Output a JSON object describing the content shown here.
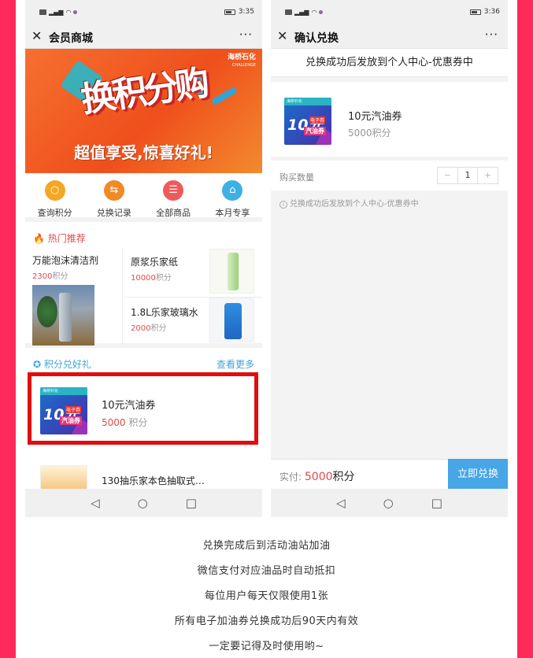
{
  "left_phone": {
    "status": {
      "time": "3:35",
      "battery": "67"
    },
    "nav": {
      "title": "会员商城",
      "more": "···",
      "close": "✕"
    },
    "banner": {
      "brand": "海桥石化",
      "brand_sub": "CHALLENGE",
      "headline": "换积分购",
      "subline": "超值享受,惊喜好礼!"
    },
    "quicknav": [
      {
        "label": "查询积分",
        "icon": "search-icon",
        "color": "#f5a623",
        "glyph": "○"
      },
      {
        "label": "兑换记录",
        "icon": "exchange-icon",
        "color": "#f08a24",
        "glyph": "⇆"
      },
      {
        "label": "全部商品",
        "icon": "list-icon",
        "color": "#ee5a5a",
        "glyph": "☰"
      },
      {
        "label": "本月专享",
        "icon": "gift-icon",
        "color": "#3db0e6",
        "glyph": "⌂"
      }
    ],
    "hot": {
      "title": "热门推荐",
      "items": [
        {
          "name": "万能泡沫清洁剂",
          "points": "2300",
          "unit": "积分"
        },
        {
          "name": "原浆乐家纸",
          "points": "10000",
          "unit": "积分"
        },
        {
          "name": "1.8L乐家玻璃水",
          "points": "2000",
          "unit": "积分"
        }
      ]
    },
    "exchange": {
      "title": "积分兑好礼",
      "see_more": "查看更多",
      "item1": {
        "name": "10元汽油券",
        "points": "5000",
        "unit": " 积分"
      },
      "item2": {
        "name": "130抽乐家本色抽取式…"
      }
    },
    "coupon_art": {
      "mini": "海桥石化",
      "ten": "10元",
      "tag": "电子券",
      "gas": "汽油券"
    }
  },
  "right_phone": {
    "status": {
      "time": "3:36",
      "battery": "67"
    },
    "nav": {
      "title": "确认兑换",
      "more": "···",
      "close": "✕"
    },
    "tip": "兑换成功后发放到个人中心-优惠券中",
    "order": {
      "name": "10元汽油券",
      "price": "5000积分"
    },
    "quantity": {
      "label": "购买数量",
      "minus": "−",
      "value": "1",
      "plus": "+"
    },
    "note": "兑换成功后发放到个人中心-优惠券中",
    "pay": {
      "label": "实付:",
      "amount": "5000",
      "unit": "积分",
      "button": "立即兑换"
    }
  },
  "android_nav": {
    "back": "◁",
    "home": "○",
    "recent": "□"
  },
  "rules": [
    "兑换完成后到活动油站加油",
    "微信支付对应油品时自动抵扣",
    "每位用户每天仅限使用1张",
    "所有电子加油券兑换成功后90天内有效",
    "一定要记得及时使用哟~"
  ],
  "colors": {
    "background": "#ff2a5a",
    "accent_red": "#e24a4a",
    "accent_blue": "#3da5d8",
    "pay_button": "#46a6e6",
    "highlight": "#e00e0e"
  }
}
